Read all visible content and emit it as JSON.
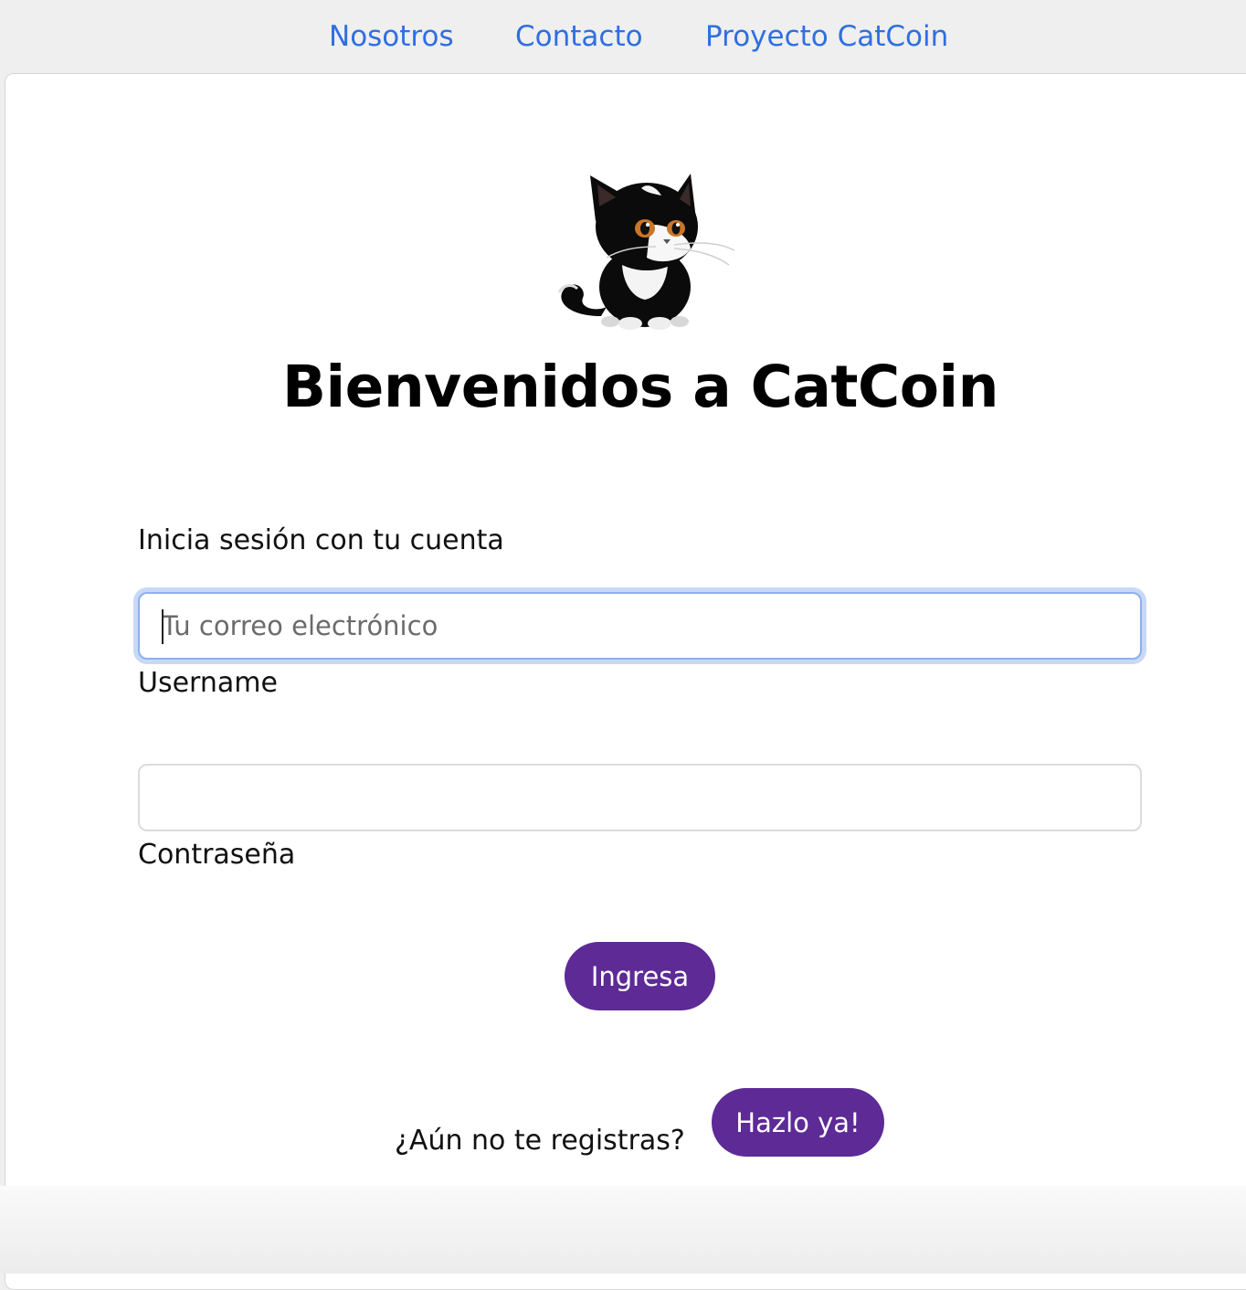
{
  "nav": {
    "links": [
      "Nosotros",
      "Contacto",
      "Proyecto CatCoin"
    ]
  },
  "logo": {
    "icon": "cat-logo-icon"
  },
  "header": {
    "title": "Bienvenidos a CatCoin"
  },
  "login": {
    "subtitle": "Inicia sesión con tu cuenta",
    "email": {
      "placeholder": "Tu correo electrónico",
      "value": "",
      "label": "Username"
    },
    "password": {
      "placeholder": "",
      "value": "",
      "label": "Contraseña"
    },
    "submit_label": "Ingresa"
  },
  "register": {
    "prompt": "¿Aún no te registras?",
    "button_label": "Hazlo ya!"
  },
  "colors": {
    "link": "#2f6fe0",
    "accent": "#5d2a96",
    "focus_ring": "#c8d9f7"
  }
}
